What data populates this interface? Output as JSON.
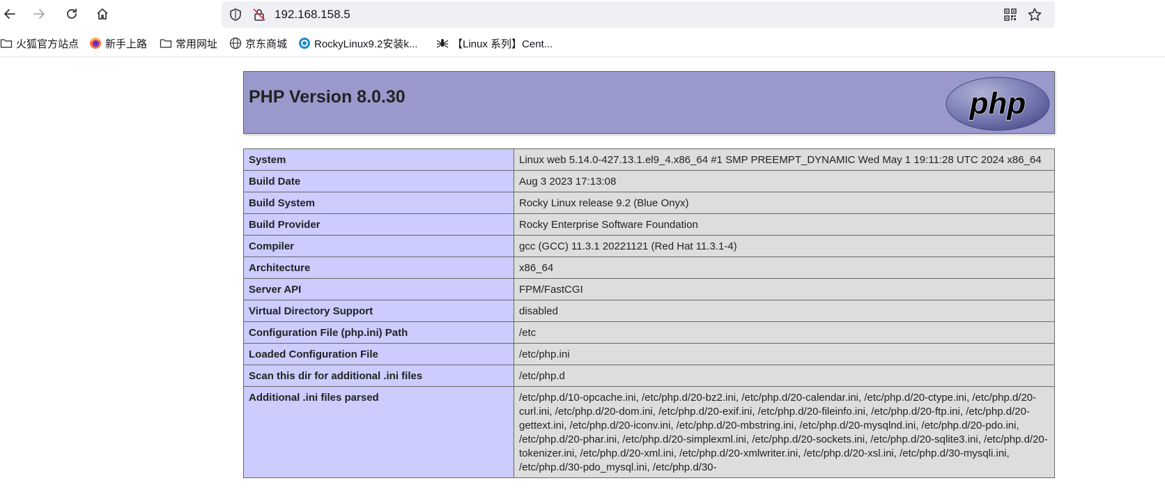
{
  "browser": {
    "url": "192.168.158.5",
    "bookmarks": [
      {
        "label": "火狐官方站点",
        "icon": "folder-icon"
      },
      {
        "label": "新手上路",
        "icon": "firefox-icon"
      },
      {
        "label": "常用网址",
        "icon": "folder-icon"
      },
      {
        "label": "京东商城",
        "icon": "globe-icon"
      },
      {
        "label": "RockyLinux9.2安装k...",
        "icon": "site-icon"
      },
      {
        "label": "【Linux 系列】Cent...",
        "icon": "spider-icon"
      }
    ]
  },
  "phpinfo": {
    "title": "PHP Version 8.0.30",
    "logo_text": "php",
    "colors": {
      "header": "#9999cc",
      "key_cell": "#ccccff",
      "value_cell": "#dddddd"
    },
    "rows": [
      {
        "key": "System",
        "value": "Linux web 5.14.0-427.13.1.el9_4.x86_64 #1 SMP PREEMPT_DYNAMIC Wed May 1 19:11:28 UTC 2024 x86_64"
      },
      {
        "key": "Build Date",
        "value": "Aug 3 2023 17:13:08"
      },
      {
        "key": "Build System",
        "value": "Rocky Linux release 9.2 (Blue Onyx)"
      },
      {
        "key": "Build Provider",
        "value": "Rocky Enterprise Software Foundation"
      },
      {
        "key": "Compiler",
        "value": "gcc (GCC) 11.3.1 20221121 (Red Hat 11.3.1-4)"
      },
      {
        "key": "Architecture",
        "value": "x86_64"
      },
      {
        "key": "Server API",
        "value": "FPM/FastCGI"
      },
      {
        "key": "Virtual Directory Support",
        "value": "disabled"
      },
      {
        "key": "Configuration File (php.ini) Path",
        "value": "/etc"
      },
      {
        "key": "Loaded Configuration File",
        "value": "/etc/php.ini"
      },
      {
        "key": "Scan this dir for additional .ini files",
        "value": "/etc/php.d"
      },
      {
        "key": "Additional .ini files parsed",
        "value": "/etc/php.d/10-opcache.ini, /etc/php.d/20-bz2.ini, /etc/php.d/20-calendar.ini, /etc/php.d/20-ctype.ini, /etc/php.d/20-curl.ini, /etc/php.d/20-dom.ini, /etc/php.d/20-exif.ini, /etc/php.d/20-fileinfo.ini, /etc/php.d/20-ftp.ini, /etc/php.d/20-gettext.ini, /etc/php.d/20-iconv.ini, /etc/php.d/20-mbstring.ini, /etc/php.d/20-mysqlnd.ini, /etc/php.d/20-pdo.ini, /etc/php.d/20-phar.ini, /etc/php.d/20-simplexml.ini, /etc/php.d/20-sockets.ini, /etc/php.d/20-sqlite3.ini, /etc/php.d/20-tokenizer.ini, /etc/php.d/20-xml.ini, /etc/php.d/20-xmlwriter.ini, /etc/php.d/20-xsl.ini, /etc/php.d/30-mysqli.ini, /etc/php.d/30-pdo_mysql.ini, /etc/php.d/30-"
      }
    ]
  }
}
